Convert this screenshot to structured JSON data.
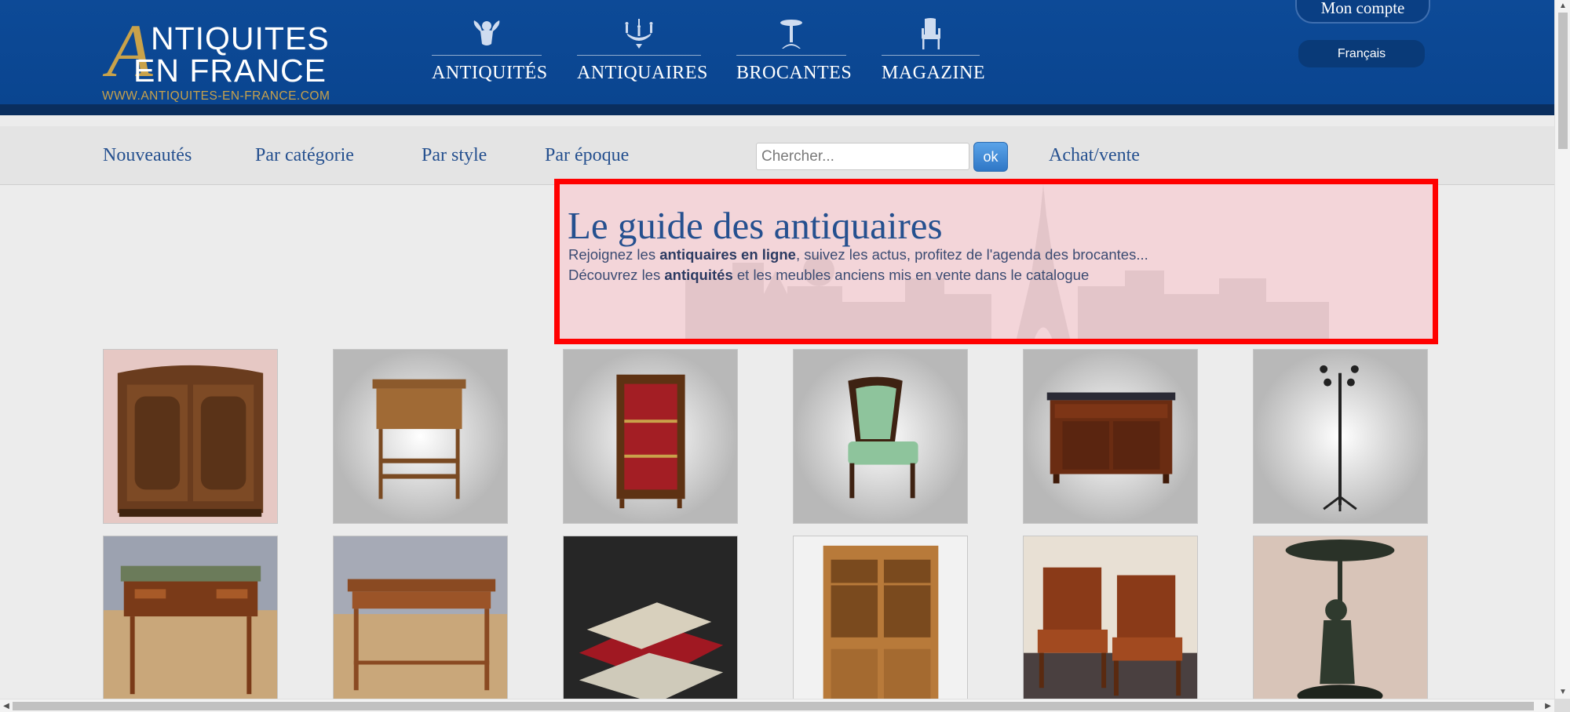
{
  "logo": {
    "line1": "NTIQUITES",
    "letter": "A",
    "line2": "EN FRANCE",
    "url": "WWW.ANTIQUITES-EN-FRANCE.COM"
  },
  "main_nav": [
    {
      "label": "ANTIQUITÉS",
      "icon": "cherub-icon"
    },
    {
      "label": "ANTIQUAIRES",
      "icon": "chandelier-icon"
    },
    {
      "label": "BROCANTES",
      "icon": "gueridon-table-icon"
    },
    {
      "label": "MAGAZINE",
      "icon": "armchair-icon"
    }
  ],
  "account": {
    "label": "Mon compte"
  },
  "language": {
    "label": "Français"
  },
  "subnav": {
    "links": [
      "Nouveautés",
      "Par catégorie",
      "Par style",
      "Par époque"
    ],
    "search_placeholder": "Chercher...",
    "search_value": "",
    "ok_label": "ok",
    "buy_sell": "Achat/vente"
  },
  "hero": {
    "title": "Le guide des antiquaires",
    "line1_a": "Rejoignez les ",
    "line1_b": "antiquaires en ligne",
    "line1_c": ", suivez les actus, profitez de l'agenda des brocantes...",
    "line2_a": "Découvrez les ",
    "line2_b": "antiquités",
    "line2_c": " et les meubles anciens mis en vente dans le catalogue"
  },
  "products": [
    {
      "name": "armoire",
      "kind": "product-armoire"
    },
    {
      "name": "side-table",
      "kind": "product-side-table"
    },
    {
      "name": "vitrine",
      "kind": "product-vitrine"
    },
    {
      "name": "chair",
      "kind": "product-chair"
    },
    {
      "name": "commode",
      "kind": "product-commode"
    },
    {
      "name": "coat-stand",
      "kind": "product-coat-stand"
    },
    {
      "name": "desk",
      "kind": "product-desk"
    },
    {
      "name": "console-table",
      "kind": "product-console-table"
    },
    {
      "name": "boxes",
      "kind": "product-boxes"
    },
    {
      "name": "bookcase",
      "kind": "product-bookcase"
    },
    {
      "name": "leather-chairs",
      "kind": "product-leather-chairs"
    },
    {
      "name": "bronze-statue",
      "kind": "product-bronze-statue"
    }
  ],
  "colors": {
    "header_bg": "#0d4a97",
    "accent_gold": "#c9a24a",
    "link_blue": "#25508f",
    "highlight_border": "#ff0000",
    "highlight_fill": "#f3d5d9"
  }
}
